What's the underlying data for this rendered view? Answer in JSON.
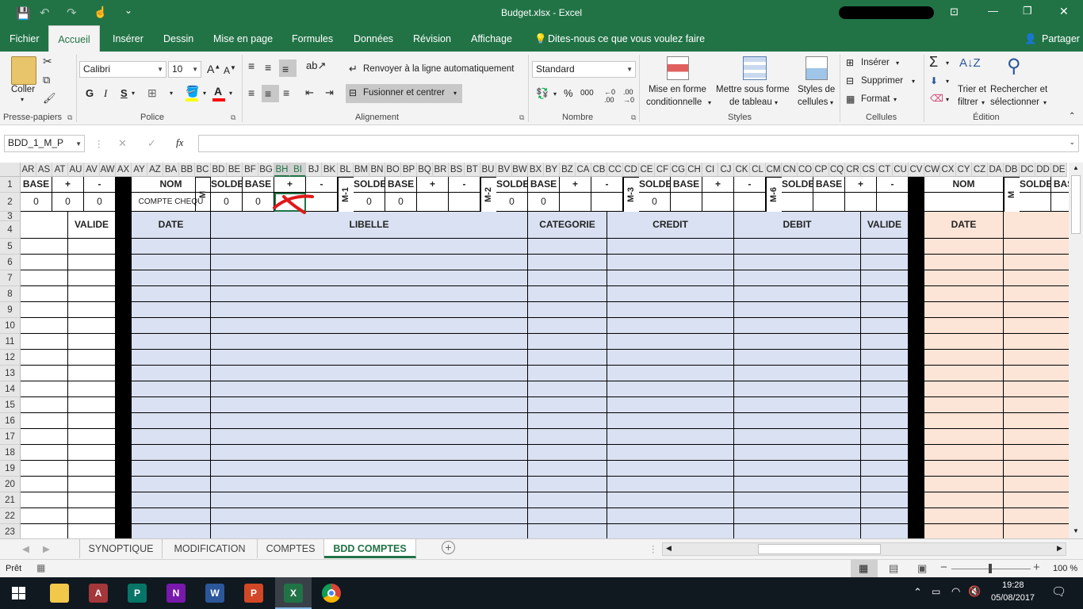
{
  "window": {
    "title": "Budget.xlsx  -  Excel",
    "minimize": "—",
    "restore": "❐",
    "close": "✕",
    "ribbon_display": "⊡"
  },
  "menu": {
    "file": "Fichier",
    "tabs": [
      "Accueil",
      "Insérer",
      "Dessin",
      "Mise en page",
      "Formules",
      "Données",
      "Révision",
      "Affichage"
    ],
    "tell_me": "Dites-nous ce que vous voulez faire",
    "share": "Partager"
  },
  "ribbon": {
    "clipboard": {
      "paste": "Coller",
      "label": "Presse-papiers"
    },
    "font": {
      "name": "Calibri",
      "size": "10",
      "bold": "G",
      "italic": "I",
      "underline": "S",
      "label": "Police"
    },
    "alignment": {
      "wrap": "Renvoyer à la ligne automatiquement",
      "merge": "Fusionner et centrer",
      "label": "Alignement"
    },
    "number": {
      "format": "Standard",
      "percent": "%",
      "thousands": "000",
      "label": "Nombre"
    },
    "styles": {
      "conditional": [
        "Mise en forme",
        "conditionnelle"
      ],
      "table": [
        "Mettre sous forme",
        "de tableau"
      ],
      "cell_styles": [
        "Styles de",
        "cellules"
      ],
      "label": "Styles"
    },
    "cells": {
      "insert": "Insérer",
      "delete": "Supprimer",
      "format": "Format",
      "label": "Cellules"
    },
    "editing": {
      "sort": [
        "Trier et",
        "filtrer"
      ],
      "find": [
        "Rechercher et",
        "sélectionner"
      ],
      "label": "Édition"
    }
  },
  "formula_bar": {
    "name_box": "BDD_1_M_P",
    "fx": "fx",
    "cancel": "✕",
    "enter": "✓",
    "content": ""
  },
  "grid": {
    "columns": [
      "AR",
      "AS",
      "AT",
      "AU",
      "AV",
      "AW",
      "AX",
      "AY",
      "AZ",
      "BA",
      "BB",
      "BC",
      "BD",
      "BE",
      "BF",
      "BG",
      "BH",
      "BI",
      "BJ",
      "BK",
      "BL",
      "BM",
      "BN",
      "BO",
      "BP",
      "BQ",
      "BR",
      "BS",
      "BT",
      "BU",
      "BV",
      "BW",
      "BX",
      "BY",
      "BZ",
      "CA",
      "CB",
      "CC",
      "CD",
      "CE",
      "CF",
      "CG",
      "CH",
      "CI",
      "CJ",
      "CK",
      "CL",
      "CM",
      "CN",
      "CO",
      "CP",
      "CQ",
      "CR",
      "CS",
      "CT",
      "CU",
      "CV",
      "CW",
      "CX",
      "CY",
      "CZ",
      "DA",
      "DB",
      "DC",
      "DD",
      "DE"
    ],
    "rows": [
      "1",
      "2",
      "3",
      "4",
      "5",
      "6",
      "7",
      "8",
      "9",
      "10",
      "11",
      "12",
      "13",
      "14",
      "15",
      "16",
      "17",
      "18",
      "19",
      "20",
      "21",
      "22",
      "23"
    ],
    "row1": {
      "base": "BASE",
      "plus": "+",
      "minus": "-",
      "nom": "NOM",
      "solde": "SOLDE",
      "m": "M",
      "m1": "M-1",
      "m2": "M-2",
      "m3": "M-3",
      "m6": "M-6"
    },
    "row2": {
      "zero": "0",
      "compte": "COMPTE CHEQU"
    },
    "headers": {
      "valide": "VALIDE",
      "date": "DATE",
      "libelle": "LIBELLE",
      "categorie": "CATEGORIE",
      "credit": "CREDIT",
      "debit": "DEBIT"
    }
  },
  "sheets": {
    "tabs": [
      "SYNOPTIQUE",
      "MODIFICATION",
      "COMPTES",
      "BDD COMPTES"
    ],
    "active": "BDD COMPTES",
    "add": "+"
  },
  "status": {
    "ready": "Prêt",
    "zoom": "100 %"
  },
  "taskbar": {
    "time": "19:28",
    "date": "05/08/2017"
  },
  "colors": {
    "excel_green": "#217346",
    "blue_fill": "#d9e1f2",
    "peach_fill": "#fce4d6",
    "black_col": "#000000"
  }
}
